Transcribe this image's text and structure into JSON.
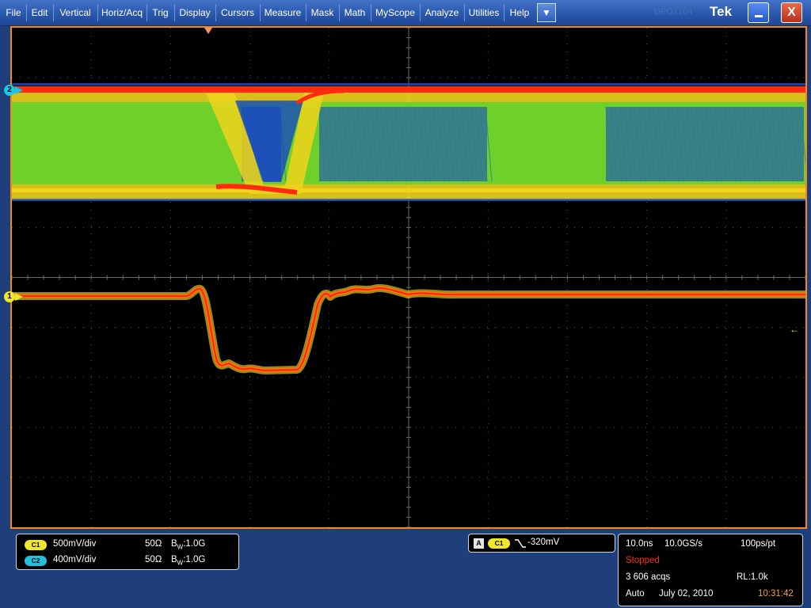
{
  "menu": {
    "items": [
      "File",
      "Edit",
      "Vertical",
      "Horiz/Acq",
      "Trig",
      "Display",
      "Cursors",
      "Measure",
      "Mask",
      "Math",
      "MyScope",
      "Analyze",
      "Utilities",
      "Help"
    ],
    "dropdown_icon": "chevron-down-icon",
    "ghost_label": "DPO7104",
    "brand": "Tek",
    "minimize_icon": "minimize-icon",
    "close_icon": "close-icon",
    "close_glyph": "X"
  },
  "display": {
    "trigger_position_icon": "trigger-position-icon",
    "ch2_marker_label": "2",
    "ch1_marker_label": "1",
    "trigger_level_glyph": "←",
    "colors": {
      "graticule_border": "#f08c14",
      "grid": "#5a5a5a",
      "ch1": "#f2e62a",
      "ch2": "#17c8e8",
      "persistence_hot": "#ff2a10",
      "persistence_warm": "#f0d41c",
      "persistence_mid": "#6ed028",
      "persistence_cold": "#1440c8"
    }
  },
  "vertical": {
    "channels": [
      {
        "chip": "C1",
        "scale": "500mV/div",
        "termination": "50Ω",
        "bw_prefix": "B",
        "bw_sub": "W",
        "bw_value": ":1.0G"
      },
      {
        "chip": "C2",
        "scale": "400mV/div",
        "termination": "50Ω",
        "bw_prefix": "B",
        "bw_sub": "W",
        "bw_value": ":1.0G"
      }
    ]
  },
  "trigger": {
    "type": "A",
    "source": "C1",
    "slope_icon": "falling-edge-icon",
    "level": "-320mV"
  },
  "acquisition": {
    "timebase": "10.0ns",
    "sample_rate": "10.0GS/s",
    "resolution": "100ps/pt",
    "state": "Stopped",
    "acqs": "3 606 acqs",
    "record_length": "RL:1.0k",
    "mode": "Auto",
    "date": "July 02, 2010",
    "time": "10:31:42"
  }
}
